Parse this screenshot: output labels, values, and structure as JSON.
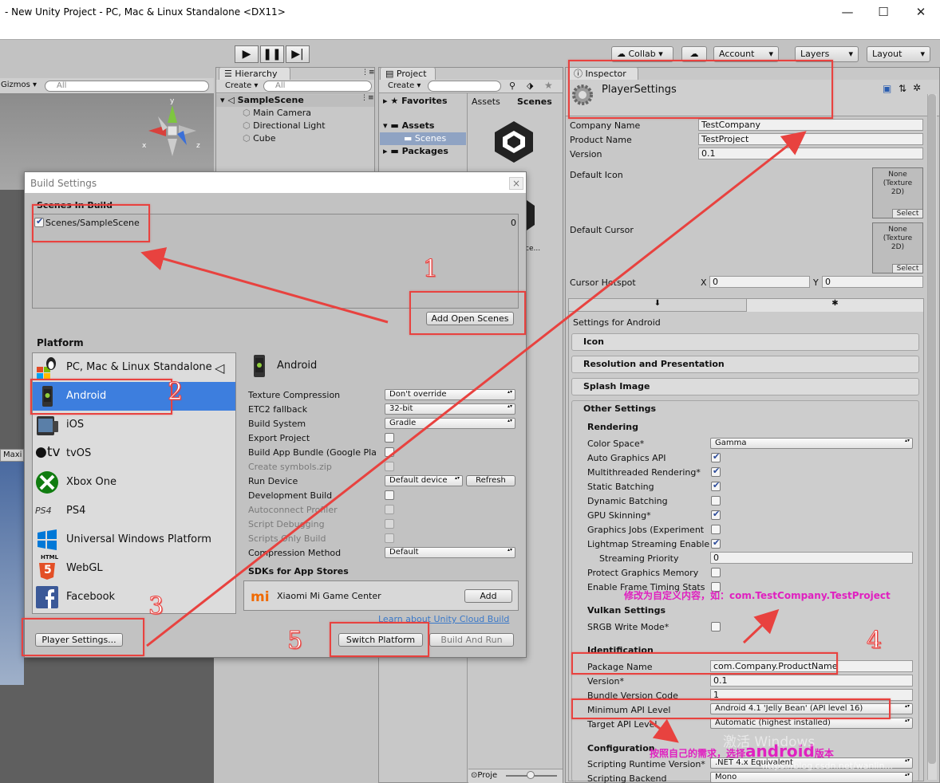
{
  "window": {
    "title": "- New Unity Project - PC, Mac & Linux Standalone <DX11>",
    "min": "—",
    "max": "☐",
    "close": "✕"
  },
  "toolbar": {
    "collab": "Collab",
    "account": "Account",
    "layers": "Layers",
    "layout": "Layout"
  },
  "scene": {
    "gizmos": "Gizmos",
    "search": "All",
    "axis_x": "x",
    "axis_y": "y",
    "axis_z": "z",
    "maxi": "Maxi"
  },
  "hierarchy": {
    "tab": "Hierarchy",
    "create": "Create",
    "search": "All",
    "scene": "SampleScene",
    "items": [
      "Main Camera",
      "Directional Light",
      "Cube"
    ]
  },
  "project": {
    "tab": "Project",
    "create": "Create",
    "favorites": "Favorites",
    "assets": "Assets",
    "scenes": "Scenes",
    "packages": "Packages",
    "crumb_assets": "Assets",
    "crumb_scenes": "Scenes",
    "file_label": "ce...",
    "bottom": "Proje"
  },
  "build": {
    "title": "Build Settings",
    "close": "×",
    "scenes_header": "Scenes In Build",
    "scene_entry": "Scenes/SampleScene",
    "scene_index": "0",
    "add_open_scenes": "Add Open Scenes",
    "platform_header": "Platform",
    "platforms": [
      "PC, Mac & Linux Standalone",
      "Android",
      "iOS",
      "tvOS",
      "Xbox One",
      "PS4",
      "Universal Windows Platform",
      "WebGL",
      "Facebook"
    ],
    "selected_platform": "Android",
    "tvos_prefix": "tv",
    "ps4_logo": "PS4",
    "html5_top": "HTML",
    "html5_num": "5",
    "options": [
      {
        "label": "Texture Compression",
        "value": "Don't override",
        "kind": "dd"
      },
      {
        "label": "ETC2 fallback",
        "value": "32-bit",
        "kind": "dd"
      },
      {
        "label": "Build System",
        "value": "Gradle",
        "kind": "dd"
      },
      {
        "label": "Export Project",
        "kind": "cb"
      },
      {
        "label": "Build App Bundle (Google Pla",
        "kind": "cb"
      },
      {
        "label": "Create symbols.zip",
        "kind": "cb",
        "disabled": true
      },
      {
        "label": "Run Device",
        "value": "Default device",
        "kind": "dd"
      },
      {
        "label": "Development Build",
        "kind": "cb"
      },
      {
        "label": "Autoconnect Profiler",
        "kind": "cb",
        "disabled": true
      },
      {
        "label": "Script Debugging",
        "kind": "cb",
        "disabled": true
      },
      {
        "label": "Scripts Only Build",
        "kind": "cb",
        "disabled": true
      },
      {
        "label": "Compression Method",
        "value": "Default",
        "kind": "dd"
      }
    ],
    "refresh": "Refresh",
    "sdks_header": "SDKs for App Stores",
    "xiaomi": "Xiaomi Mi Game Center",
    "add": "Add",
    "learn": "Learn about Unity Cloud Build",
    "player_settings": "Player Settings...",
    "switch_platform": "Switch Platform",
    "build_and_run": "Build And Run"
  },
  "inspector": {
    "tab": "Inspector",
    "title": "PlayerSettings",
    "company_label": "Company Name",
    "company": "TestCompany",
    "product_label": "Product Name",
    "product": "TestProject",
    "version_label": "Version",
    "version": "0.1",
    "default_icon": "Default Icon",
    "default_cursor": "Default Cursor",
    "tex_none": "None",
    "tex_type": "(Texture",
    "tex_2d": "2D)",
    "tex_select": "Select",
    "hotspot_label": "Cursor Hotspot",
    "hx_label": "X",
    "hx": "0",
    "hy_label": "Y",
    "hy": "0",
    "settings_for": "Settings for Android",
    "sections": [
      "Icon",
      "Resolution and Presentation",
      "Splash Image",
      "Other Settings"
    ],
    "rendering": "Rendering",
    "render_rows": [
      {
        "label": "Color Space*",
        "value": "Gamma",
        "kind": "dd"
      },
      {
        "label": "Auto Graphics API",
        "kind": "cb",
        "checked": true
      },
      {
        "label": "Multithreaded Rendering*",
        "kind": "cb",
        "checked": true
      },
      {
        "label": "Static Batching",
        "kind": "cb",
        "checked": true
      },
      {
        "label": "Dynamic Batching",
        "kind": "cb",
        "checked": false
      },
      {
        "label": "GPU Skinning*",
        "kind": "cb",
        "checked": true
      },
      {
        "label": "Graphics Jobs (Experiment",
        "kind": "cb",
        "checked": false
      },
      {
        "label": "Lightmap Streaming Enable",
        "kind": "cb",
        "checked": true
      },
      {
        "label": "Streaming Priority",
        "value": "0",
        "kind": "fld",
        "indent": true
      },
      {
        "label": "Protect Graphics Memory",
        "kind": "cb",
        "checked": false
      },
      {
        "label": "Enable Frame Timing Stats",
        "kind": "cb",
        "checked": false
      }
    ],
    "vulkan": "Vulkan Settings",
    "srgb": "SRGB Write Mode*",
    "identification": "Identification",
    "package_label": "Package Name",
    "package": "com.Company.ProductName",
    "version2_label": "Version*",
    "version2": "0.1",
    "bundle_label": "Bundle Version Code",
    "bundle": "1",
    "minapi_label": "Minimum API Level",
    "minapi": "Android 4.1 'Jelly Bean' (API level 16)",
    "target_label": "Target API Level",
    "target": "Automatic (highest installed)",
    "configuration": "Configuration",
    "runtime_label": "Scripting Runtime Version*",
    "runtime": ".NET 4.x Equivalent",
    "backend_label": "Scripting Backend",
    "backend": "Mono"
  },
  "annotations": {
    "n1": "1",
    "n2": "2",
    "n3": "3",
    "n4": "4",
    "n5": "5",
    "note_pkg": "修改为自定义内容，如：com.TestCompany.TestProject",
    "note_api_a": "按照自己的需求，选择",
    "note_api_b": "android",
    "note_api_c": "版本",
    "watermark": "激活 Windows",
    "watermark_url": "https://blog.csdn.net/wanlin..."
  },
  "colors": {
    "accent": "#3d7ede",
    "annotation": "#e8423f",
    "note": "#e020c0"
  }
}
